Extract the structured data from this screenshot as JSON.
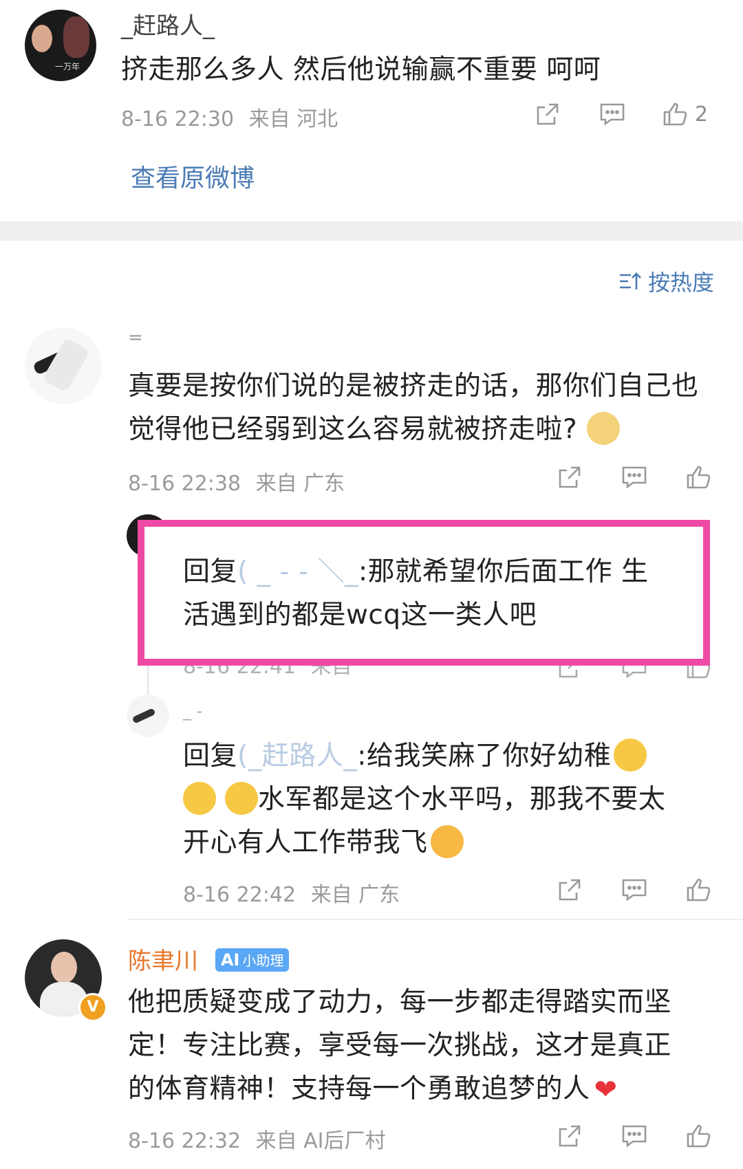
{
  "comment1": {
    "username": "_赶路人_",
    "text": "挤走那么多人 然后他说输赢不重要 呵呵",
    "time": "8-16 22:30",
    "from": "来自 河北",
    "likes": "2",
    "view_original": "查看原微博"
  },
  "sort": {
    "label": "按热度"
  },
  "comment2": {
    "username": "=",
    "text": "真要是按你们说的是被挤走的话，那你们自己也觉得他已经弱到这么容易就被挤走啦?",
    "time": "8-16 22:38",
    "from": "来自 广东"
  },
  "reply1": {
    "text": "回复(______________):那就希望你后面工作 生活遇到的都是wcq这一类人吧",
    "text_line1": "回复",
    "mention": "( _ - - ＼_",
    "text_after": ":那就希望你后面工作 生",
    "text_line2": "活遇到的都是wcq这一类人吧",
    "time": "8-16 22:41",
    "from": "来自"
  },
  "reply2": {
    "username": "_ -",
    "prefix": "回复",
    "mention": "(_赶路人_",
    "text_a": ":给我笑麻了你好幼稚",
    "text_b": "水军都是这个水平吗，那我不要太",
    "text_c": "开心有人工作带我飞",
    "time": "8-16 22:42",
    "from": "来自 广东"
  },
  "comment3": {
    "username": "陈聿川",
    "badge_ai": "AI",
    "badge_text": "小助理",
    "verified": "V",
    "text_l1": "他把质疑变成了动力，每一步都走得踏实而坚",
    "text_l2": "定！专注比赛，享受每一次挑战，这才是真正",
    "text_l3": "的体育精神！支持每一个勇敢追梦的人",
    "heart": "❤",
    "time": "8-16 22:32",
    "from": "来自 AI后厂村"
  },
  "colors": {
    "link": "#4a7bb5",
    "highlight_box": "#ee4aa5",
    "orange_name": "#e8772c"
  },
  "icons": [
    "share-icon",
    "comment-icon",
    "like-icon",
    "sort-icon"
  ]
}
